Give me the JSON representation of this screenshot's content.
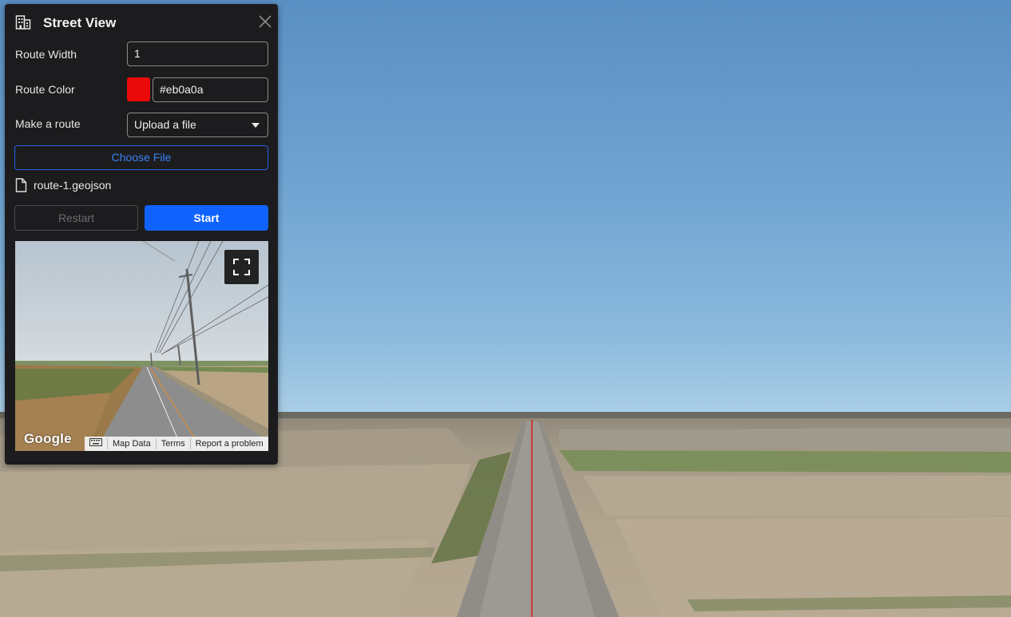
{
  "panel": {
    "title": "Street View",
    "route_width": {
      "label": "Route Width",
      "value": "1"
    },
    "route_color": {
      "label": "Route Color",
      "value": "#eb0a0a",
      "swatch": "#eb0a0a"
    },
    "make_route": {
      "label": "Make a route",
      "selected": "Upload a file"
    },
    "choose_file_label": "Choose File",
    "file_name": "route-1.geojson",
    "restart_label": "Restart",
    "start_label": "Start"
  },
  "street_view": {
    "logo": "Google",
    "map_data": "Map Data",
    "terms": "Terms",
    "report": "Report a problem"
  },
  "colors": {
    "accent": "#0f62fe",
    "route": "#eb0a0a",
    "panel_bg": "#1c1c1e"
  },
  "icons": [
    "building-icon",
    "close-icon",
    "chevron-down-icon",
    "file-icon",
    "fullscreen-icon",
    "keyboard-icon"
  ]
}
